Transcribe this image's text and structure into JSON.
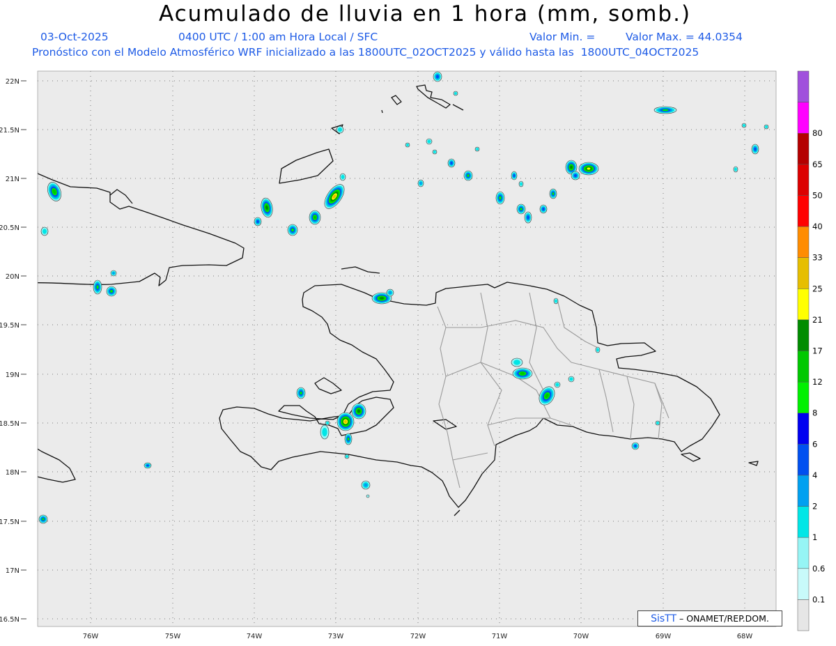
{
  "header": {
    "title": "Acumulado de lluvia en 1 hora (mm, somb.)",
    "date": "03-Oct-2025",
    "time": "0400 UTC / 1:00 am Hora Local / SFC",
    "valor_min_label": "Valor Min. =",
    "valor_max_label": "Valor Max. = 44.0354",
    "model_line": "Pronóstico con el Modelo Atmosférico WRF inicializado a las 1800UTC_02OCT2025 y válido hasta las  1800UTC_04OCT2025"
  },
  "map": {
    "lat_labels": [
      "22N",
      "21.5N",
      "21N",
      "20.5N",
      "20N",
      "19.5N",
      "19N",
      "18.5N",
      "18N",
      "17.5N",
      "17N",
      "16.5N"
    ],
    "lon_labels": [
      "76W",
      "75W",
      "74W",
      "73W",
      "72W",
      "71W",
      "70W",
      "69W",
      "68W"
    ],
    "grid": "dotted",
    "background": "#ebebeb"
  },
  "colorbar": {
    "levels": [
      "0.1",
      "0.6",
      "1",
      "2",
      "4",
      "6",
      "8",
      "12",
      "17",
      "21",
      "25",
      "33",
      "40",
      "50",
      "65",
      "80"
    ],
    "colors": [
      "#e6e6e6",
      "#c8fafa",
      "#96f5f5",
      "#00e6e6",
      "#00a0f0",
      "#0050f0",
      "#0000f0",
      "#00f000",
      "#00c800",
      "#008c00",
      "#ffff00",
      "#e6be00",
      "#ff8c00",
      "#ff0000",
      "#dc0000",
      "#b40000",
      "#ff00ff",
      "#a050dc"
    ]
  },
  "credit": {
    "brand": "SisTT",
    "text": "– ONAMET/REP.DOM."
  }
}
